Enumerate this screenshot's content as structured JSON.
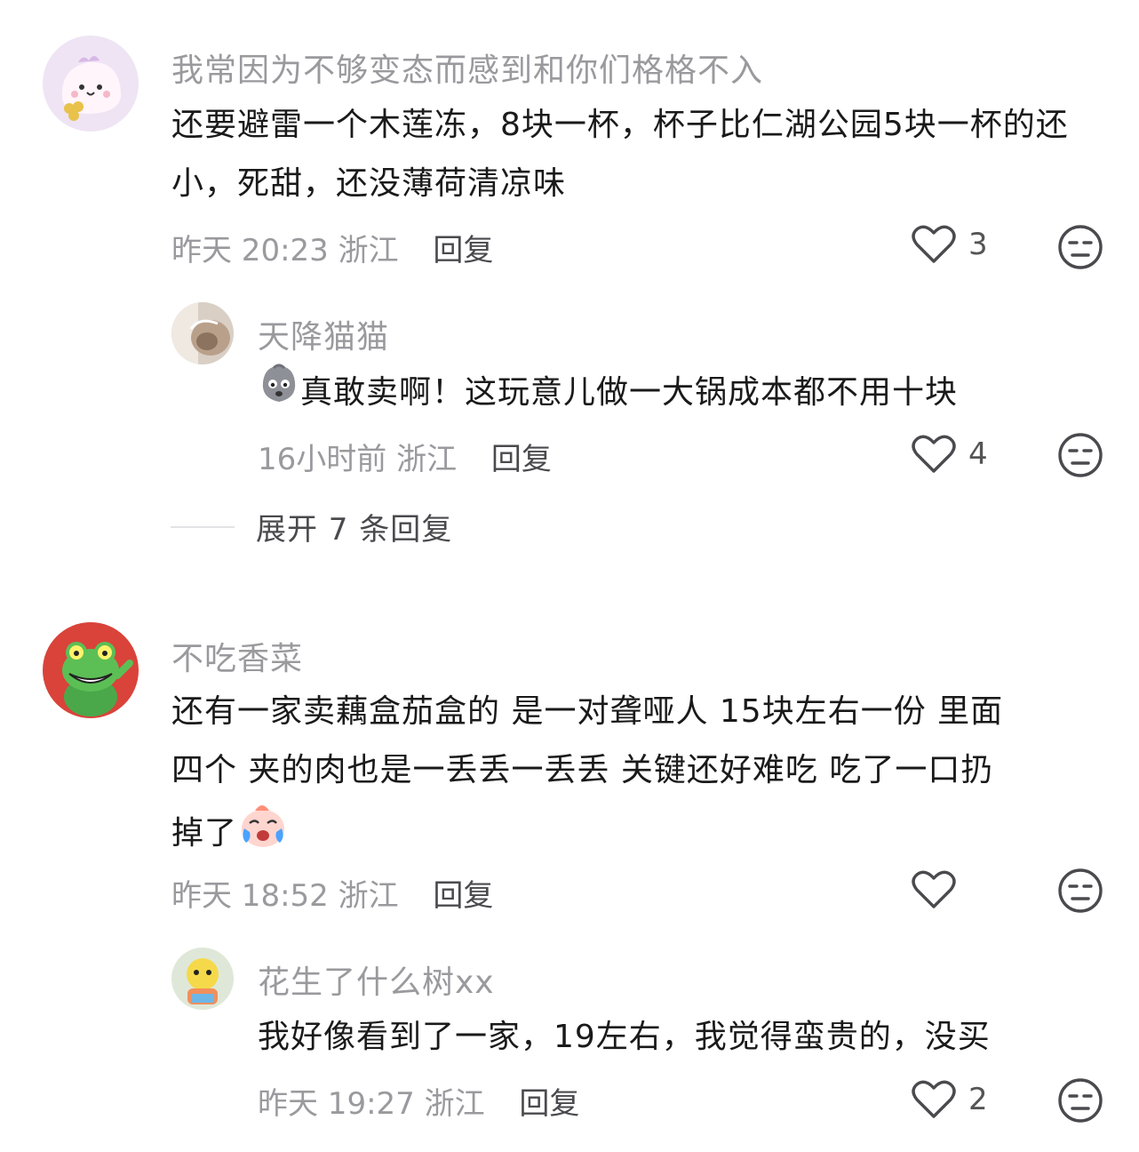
{
  "comments": [
    {
      "username": "我常因为不够变态而感到和你们格格不入",
      "text": "还要避雷一个木莲冻，8块一杯，杯子比仁湖公园5块一杯的还小，死甜，还没薄荷清凉味",
      "time": "昨天 20:23",
      "location": "浙江",
      "reply_label": "回复",
      "likes": "3",
      "replies": [
        {
          "username": "天降猫猫",
          "emoji": "skull-face-emoji",
          "text": "真敢卖啊！这玩意儿做一大锅成本都不用十块",
          "time": "16小时前",
          "location": "浙江",
          "reply_label": "回复",
          "likes": "4"
        }
      ],
      "expand_label": "展开 7 条回复"
    },
    {
      "username": "不吃香菜",
      "text_line1": "还有一家卖藕盒茄盒的 是一对聋哑人 15块左右一份 里面",
      "text_line2": "四个 夹的肉也是一丢丢一丢丢 关键还好难吃 吃了一口扔",
      "text_line3": "掉了",
      "emoji": "crying-face-emoji",
      "time": "昨天 18:52",
      "location": "浙江",
      "reply_label": "回复",
      "likes": "",
      "replies": [
        {
          "username": "花生了什么树xx",
          "text": "我好像看到了一家，19左右，我觉得蛮贵的，没买",
          "time": "昨天 19:27",
          "location": "浙江",
          "reply_label": "回复",
          "likes": "2"
        }
      ]
    }
  ],
  "icons": {
    "like": "heart-outline-icon",
    "dislike": "unamused-face-icon"
  }
}
